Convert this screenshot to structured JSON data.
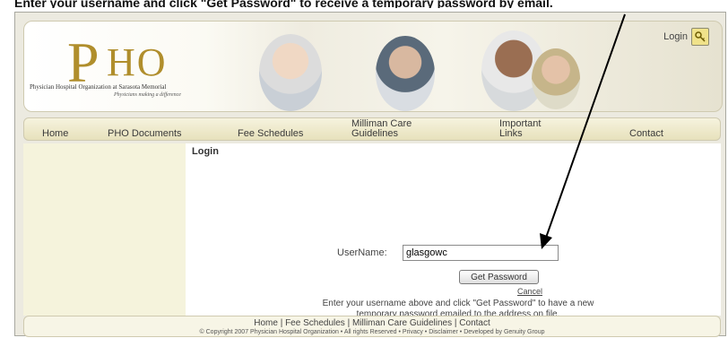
{
  "caption": "Enter your username and click \"Get Password\" to receive a temporary password by email.",
  "header": {
    "logo_p": "P",
    "logo_ho": "HO",
    "org_name": "Physician Hospital Organization at Sarasota Memorial",
    "tagline": "Physicians making a difference",
    "login_label": "Login"
  },
  "nav": {
    "home": "Home",
    "pho_documents": "PHO Documents",
    "fee_schedules": "Fee Schedules",
    "milliman_line1": "Milliman Care",
    "milliman_line2": "Guidelines",
    "important_line1": "Important",
    "important_line2": "Links",
    "contact": "Contact"
  },
  "main": {
    "heading": "Login",
    "username_label": "UserName:",
    "username_value": "glasgowc",
    "get_password_label": "Get Password",
    "cancel_label": "Cancel",
    "instructions": "Enter your username above and click \"Get Password\" to have a new temporary password emailed to the address on file."
  },
  "footer": {
    "home": "Home",
    "fee_schedules": "Fee Schedules",
    "milliman": "Milliman Care Guidelines",
    "contact": "Contact",
    "copyright": "© Copyright 2007 Physician Hospital Organization • All rights Reserved • Privacy • Disclaimer • Developed by Genuity Group"
  },
  "colors": {
    "logo_gold": "#b08e2c",
    "nav_bg": "#e7e1bc",
    "sidebar_bg": "#f5f3dc",
    "arrow": "#000000"
  },
  "icons": {
    "login_key": "key-icon"
  }
}
